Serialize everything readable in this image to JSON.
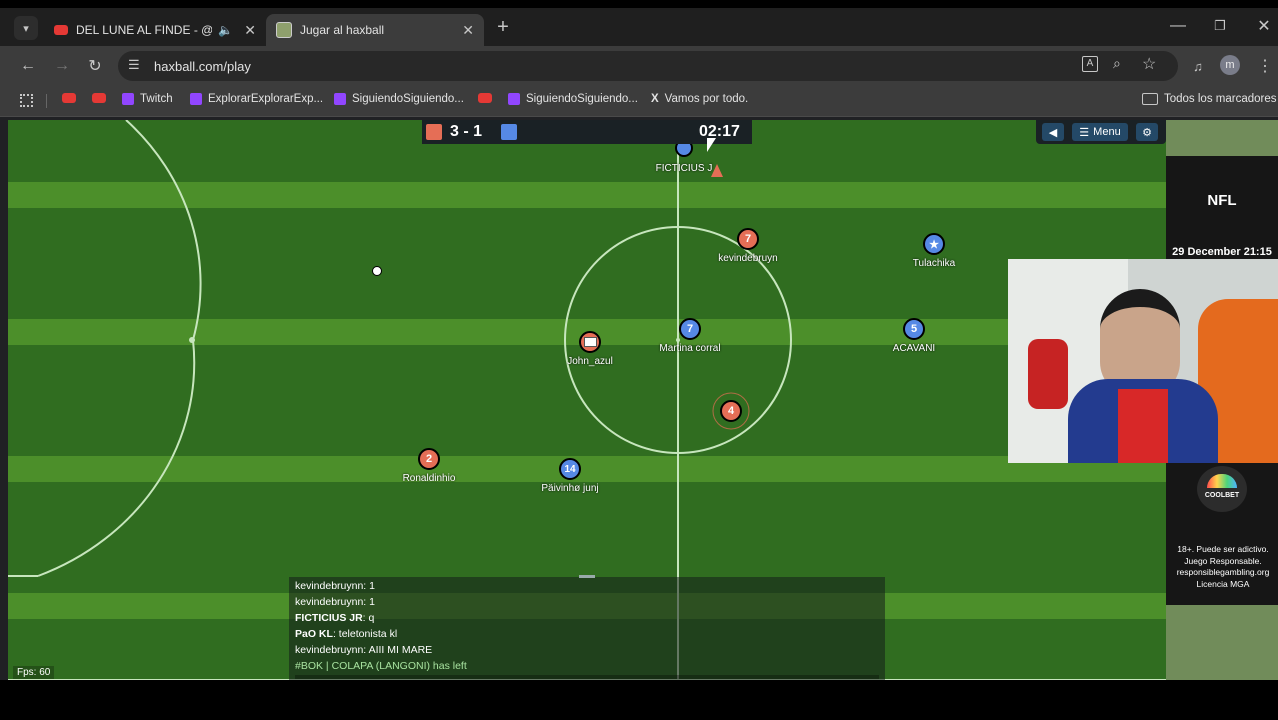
{
  "tabs": [
    {
      "title": "DEL LUNE AL FINDE - @ITH",
      "icon": "youtube-icon"
    },
    {
      "title": "Jugar al haxball",
      "icon": "haxball-icon"
    }
  ],
  "address": {
    "url": "haxball.com/play"
  },
  "bookmarks": {
    "items": [
      {
        "label": "Twitch"
      },
      {
        "label": "ExplorarExplorarExp..."
      },
      {
        "label": "SiguiendoSiguiendo..."
      },
      {
        "label": "SiguiendoSiguiendo..."
      },
      {
        "label": "Vamos por todo."
      }
    ],
    "all_label": "Todos los marcadores"
  },
  "game": {
    "score": "3 - 1",
    "timer": "02:17",
    "menu_label": "Menu",
    "fps": "Fps: 60",
    "players": [
      {
        "number": "7",
        "name": "kevindebruyn",
        "team": "red"
      },
      {
        "number": "★",
        "name": "Tulachika",
        "team": "blue"
      },
      {
        "number": "",
        "name": "John_azul",
        "team": "red"
      },
      {
        "number": "7",
        "name": "Martina corral",
        "team": "blue"
      },
      {
        "number": "5",
        "name": "ACAVANI",
        "team": "blue"
      },
      {
        "number": "4",
        "name": "",
        "team": "red"
      },
      {
        "number": "2",
        "name": "Ronaldinhio",
        "team": "red"
      },
      {
        "number": "14",
        "name": "Päivinhø junj",
        "team": "blue"
      }
    ],
    "ficticius_label": "FICTICIUS J"
  },
  "chat": [
    {
      "author": "kevindebruynn",
      "text": "1"
    },
    {
      "author": "kevindebruynn",
      "text": "1"
    },
    {
      "author": "FICTICIUS JR",
      "text": "q"
    },
    {
      "author": "PaO KL",
      "text": "teletonista kl"
    },
    {
      "author": "kevindebruynn",
      "text": "AIII MI MARE"
    },
    {
      "author": "",
      "text": "#BOK | COLAPA (LANGONI) has left"
    }
  ],
  "side_panel": {
    "league": "NFL",
    "date": "29 December 21:15",
    "brand": "COOLBET",
    "disclaimer": "18+. Puede ser adictivo. Juego Responsable. responsiblegambling.org Licencia MGA"
  },
  "colors": {
    "red_team": "#e56e56",
    "blue_team": "#5689e5",
    "pitch_dark": "#306d20",
    "pitch_light": "#4c8f2a"
  }
}
